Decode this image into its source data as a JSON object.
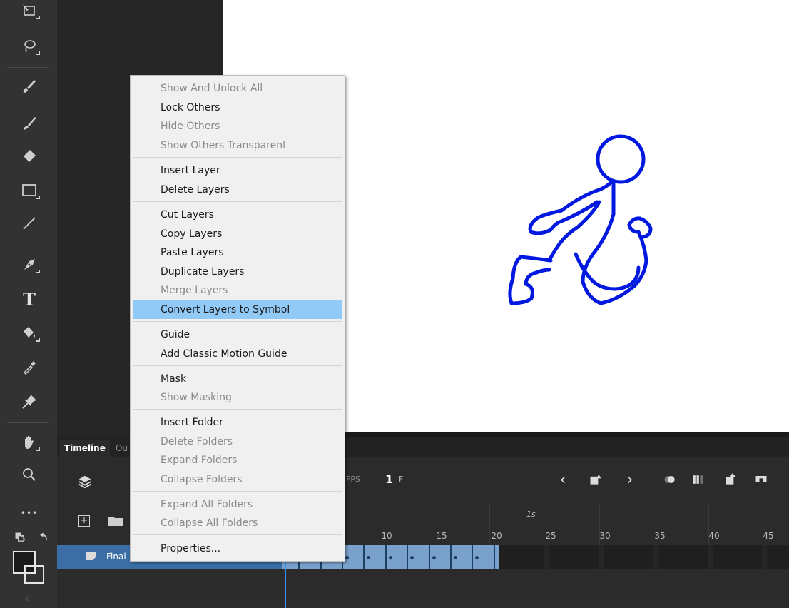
{
  "tabs": {
    "timeline": "Timeline",
    "output": "Ou"
  },
  "timeline": {
    "fps_label": "FPS",
    "frame_number": "1",
    "frame_unit": "F",
    "time_label": "1s",
    "ruler_numbers": [
      "10",
      "15",
      "20",
      "25",
      "30",
      "35",
      "40",
      "45"
    ],
    "layer_name": "Final",
    "add_layer_symbol": "+"
  },
  "context_menu": {
    "items": [
      {
        "label": "Show And Unlock All",
        "enabled": false
      },
      {
        "label": "Lock Others",
        "enabled": true
      },
      {
        "label": "Hide Others",
        "enabled": false
      },
      {
        "label": "Show Others Transparent",
        "enabled": false
      },
      {
        "label": "Insert Layer",
        "enabled": true
      },
      {
        "label": "Delete Layers",
        "enabled": true
      },
      {
        "label": "Cut Layers",
        "enabled": true
      },
      {
        "label": "Copy Layers",
        "enabled": true
      },
      {
        "label": "Paste Layers",
        "enabled": true
      },
      {
        "label": "Duplicate Layers",
        "enabled": true
      },
      {
        "label": "Merge Layers",
        "enabled": false
      },
      {
        "label": "Convert Layers to Symbol",
        "enabled": true,
        "highlighted": true
      },
      {
        "label": "Guide",
        "enabled": true
      },
      {
        "label": "Add Classic Motion Guide",
        "enabled": true
      },
      {
        "label": "Mask",
        "enabled": true
      },
      {
        "label": "Show Masking",
        "enabled": false
      },
      {
        "label": "Insert Folder",
        "enabled": true
      },
      {
        "label": "Delete Folders",
        "enabled": false
      },
      {
        "label": "Expand Folders",
        "enabled": false
      },
      {
        "label": "Collapse Folders",
        "enabled": false
      },
      {
        "label": "Expand All Folders",
        "enabled": false
      },
      {
        "label": "Collapse All Folders",
        "enabled": false
      },
      {
        "label": "Properties...",
        "enabled": true
      }
    ]
  },
  "toolbar": {
    "tools": [
      "free-transform-icon",
      "lasso-icon",
      "paint-brush-icon",
      "brush-icon",
      "eraser-icon",
      "rectangle-icon",
      "line-icon",
      "pen-icon",
      "text-icon",
      "paint-bucket-icon",
      "eyedropper-icon",
      "pin-icon",
      "hand-icon",
      "zoom-icon",
      "more-icon"
    ],
    "text_tool_glyph": "T",
    "more_glyph": "•••"
  },
  "colors": {
    "stroke": "#0018e0",
    "menu_highlight": "#91c9f7",
    "layer_selected": "#3a6ea5"
  }
}
